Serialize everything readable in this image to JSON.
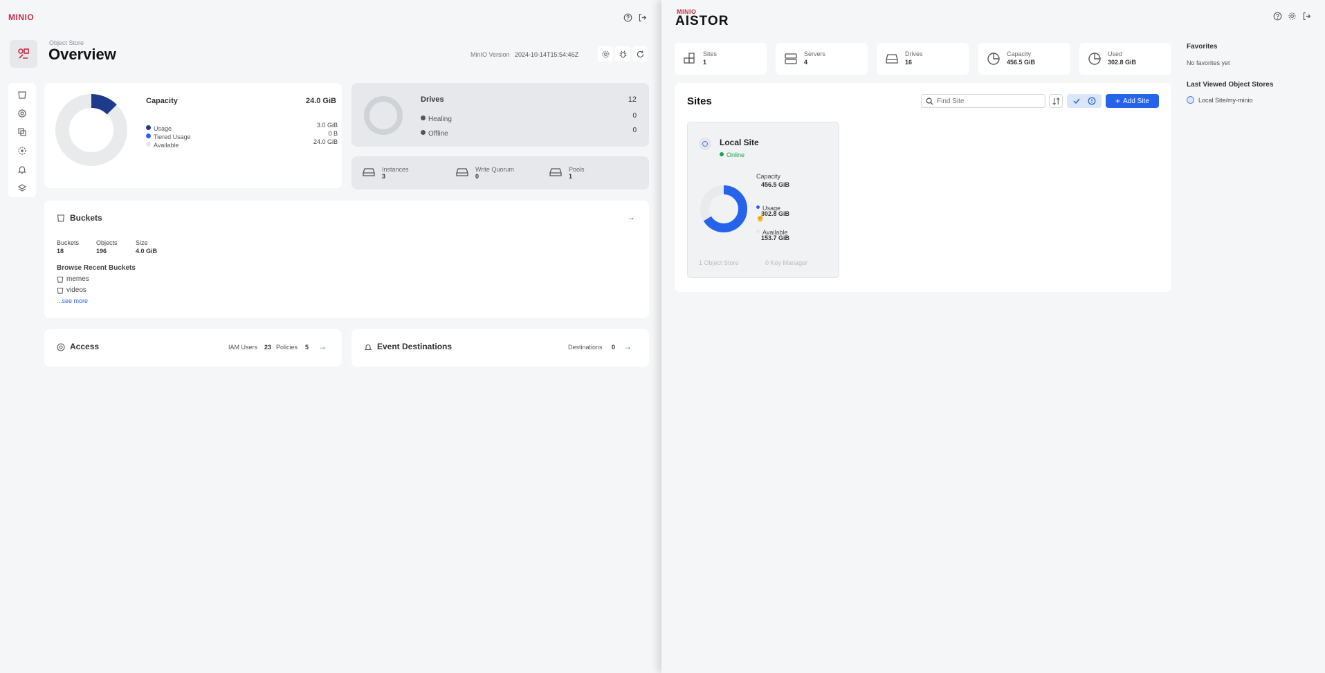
{
  "left": {
    "logo": "MINIO",
    "breadcrumb": "Object Store",
    "title": "Overview",
    "version_label": "MinIO Version",
    "version_value": "2024-10-14T15:54:46Z",
    "capacity": {
      "title": "Capacity",
      "total": "24.0 GiB",
      "legend": [
        {
          "label": "Usage",
          "value": "3.0 GiB",
          "color": "#1e3a8a"
        },
        {
          "label": "Tiered Usage",
          "value": "0 B",
          "color": "#2563eb"
        },
        {
          "label": "Available",
          "value": "24.0 GiB",
          "color": "#e5e7eb"
        }
      ],
      "usage_fraction": 0.125
    },
    "drives": {
      "title": "Drives",
      "total": "12",
      "rows": [
        {
          "label": "Healing",
          "value": "0"
        },
        {
          "label": "Offline",
          "value": "0"
        }
      ]
    },
    "servers": [
      {
        "label": "Instances",
        "value": "3"
      },
      {
        "label": "Write Quorum",
        "value": "0"
      },
      {
        "label": "Pools",
        "value": "1"
      }
    ],
    "buckets": {
      "title": "Buckets",
      "stats": [
        {
          "label": "Buckets",
          "value": "18"
        },
        {
          "label": "Objects",
          "value": "196"
        },
        {
          "label": "Size",
          "value": "4.0 GiB"
        }
      ],
      "recent_title": "Browse Recent Buckets",
      "recent": [
        "memes",
        "videos"
      ],
      "see_more": "...see more"
    },
    "access": {
      "title": "Access",
      "iam_label": "IAM Users",
      "iam_value": "23",
      "policies_label": "Policies",
      "policies_value": "5"
    },
    "events": {
      "title": "Event Destinations",
      "dest_label": "Destinations",
      "dest_value": "0"
    }
  },
  "right": {
    "logo_top": "MINIO",
    "logo_main": "AISTOR",
    "stats": [
      {
        "label": "Sites",
        "value": "1",
        "icon": "sites-icon"
      },
      {
        "label": "Servers",
        "value": "4",
        "icon": "servers-icon"
      },
      {
        "label": "Drives",
        "value": "16",
        "icon": "drives-icon"
      },
      {
        "label": "Capacity",
        "value": "456.5 GiB",
        "icon": "pie-icon"
      },
      {
        "label": "Used",
        "value": "302.8 GiB",
        "icon": "pie-icon"
      }
    ],
    "sites": {
      "title": "Sites",
      "search_placeholder": "Find Site",
      "add_label": "Add Site",
      "card": {
        "name": "Local Site",
        "status": "Online",
        "capacity_label": "Capacity",
        "capacity_value": "456.5 GiB",
        "usage_label": "Usage",
        "usage_value": "302.8 GiB",
        "available_label": "Available",
        "available_value": "153.7 GiB",
        "usage_fraction": 0.663,
        "footer_left": "1 Object Store",
        "footer_right": "0 Key Manager"
      }
    },
    "favorites": {
      "title": "Favorites",
      "empty": "No favorites yet",
      "recent_title": "Last Viewed Object Stores",
      "recent_item": "Local Site/my-minio"
    }
  }
}
